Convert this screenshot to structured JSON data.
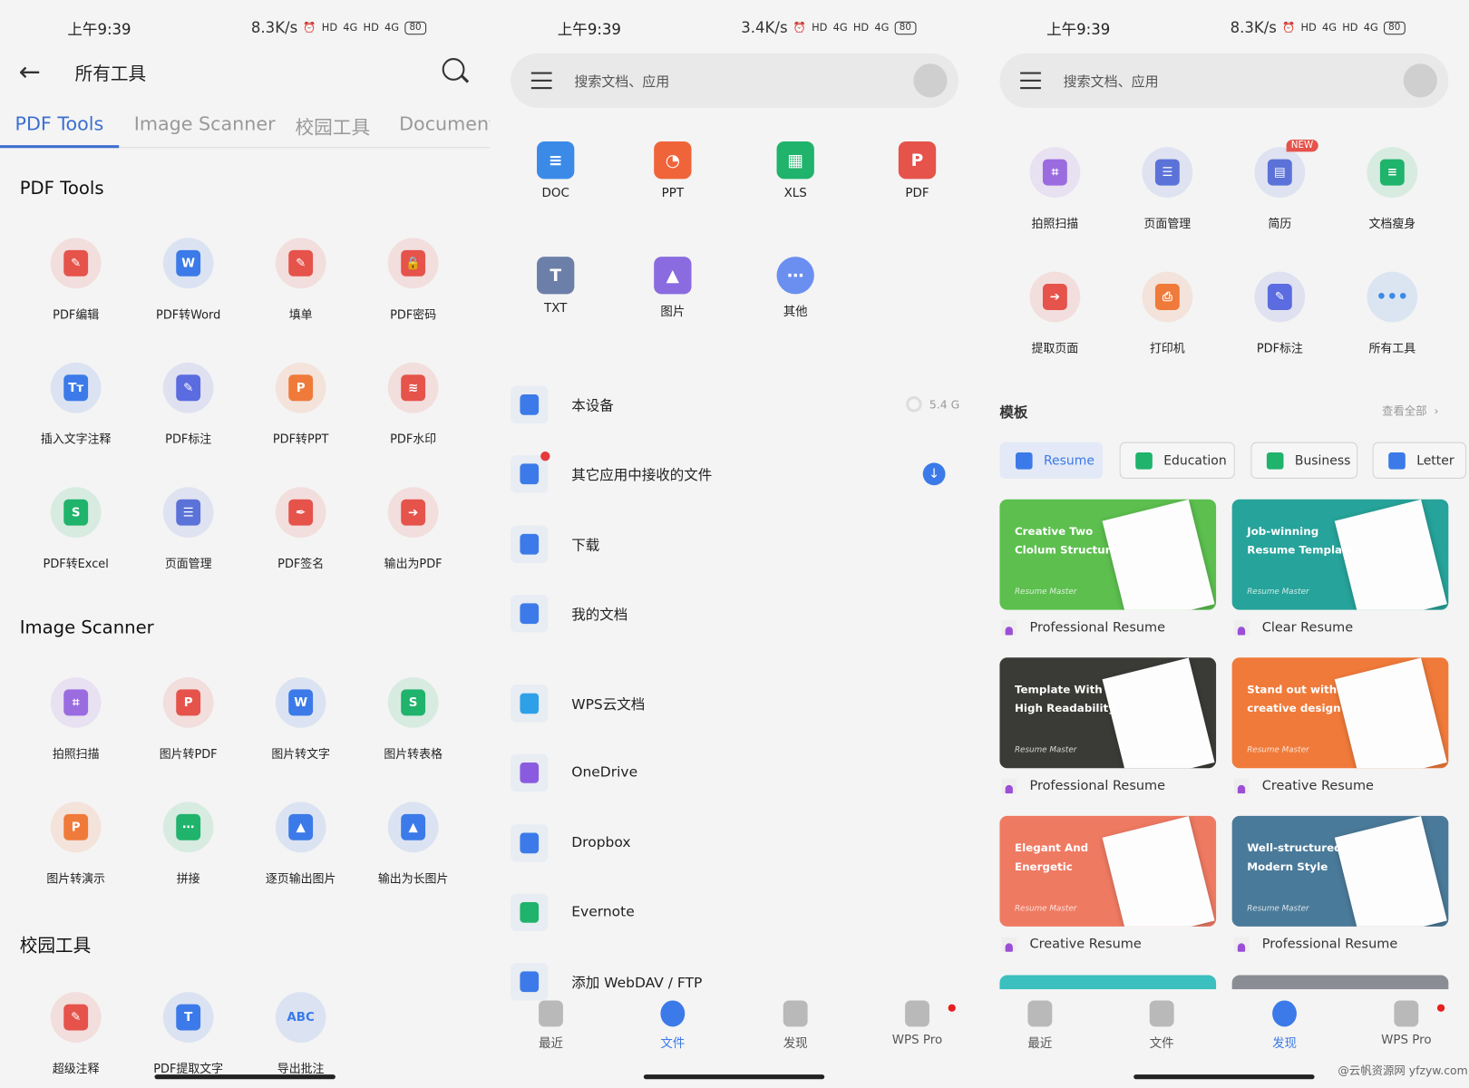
{
  "status": {
    "time": "上午9:39",
    "speeds": [
      "8.3K/s",
      "3.4K/s",
      "8.3K/s"
    ],
    "battery": "80",
    "net": "4G",
    "hd": "HD"
  },
  "left": {
    "title": "所有工具",
    "tabs": [
      "PDF Tools",
      "Image Scanner",
      "校园工具",
      "Document"
    ],
    "sections": [
      {
        "title": "PDF Tools",
        "tools": [
          {
            "label": "PDF编辑",
            "icon": "pdf-edit-icon",
            "color": "#e5534b",
            "g": "✎"
          },
          {
            "label": "PDF转Word",
            "icon": "pdf-to-word-icon",
            "color": "#3b7ae8",
            "g": "W"
          },
          {
            "label": "填单",
            "icon": "fill-form-icon",
            "color": "#e5534b",
            "g": "✎"
          },
          {
            "label": "PDF密码",
            "icon": "pdf-password-icon",
            "color": "#e5534b",
            "g": "🔒"
          },
          {
            "label": "插入文字注释",
            "icon": "text-annotation-icon",
            "color": "#3b7ae8",
            "g": "Tт"
          },
          {
            "label": "PDF标注",
            "icon": "pdf-markup-icon",
            "color": "#5b6be0",
            "g": "✎"
          },
          {
            "label": "PDF转PPT",
            "icon": "pdf-to-ppt-icon",
            "color": "#f07a3a",
            "g": "P"
          },
          {
            "label": "PDF水印",
            "icon": "pdf-watermark-icon",
            "color": "#e5534b",
            "g": "≋"
          },
          {
            "label": "PDF转Excel",
            "icon": "pdf-to-excel-icon",
            "color": "#1fb36b",
            "g": "S"
          },
          {
            "label": "页面管理",
            "icon": "page-manage-icon",
            "color": "#5b72d8",
            "g": "☰"
          },
          {
            "label": "PDF签名",
            "icon": "pdf-sign-icon",
            "color": "#e5534b",
            "g": "✒"
          },
          {
            "label": "输出为PDF",
            "icon": "export-pdf-icon",
            "color": "#e5534b",
            "g": "➔"
          }
        ]
      },
      {
        "title": "Image Scanner",
        "tools": [
          {
            "label": "拍照扫描",
            "icon": "scan-icon",
            "color": "#9b6be0",
            "g": "⌗"
          },
          {
            "label": "图片转PDF",
            "icon": "image-to-pdf-icon",
            "color": "#e5534b",
            "g": "P"
          },
          {
            "label": "图片转文字",
            "icon": "image-to-text-icon",
            "color": "#3b7ae8",
            "g": "W"
          },
          {
            "label": "图片转表格",
            "icon": "image-to-sheet-icon",
            "color": "#1fb36b",
            "g": "S"
          },
          {
            "label": "图片转演示",
            "icon": "image-to-ppt-icon",
            "color": "#f07a3a",
            "g": "P"
          },
          {
            "label": "拼接",
            "icon": "stitch-icon",
            "color": "#1fb36b",
            "g": "⋯"
          },
          {
            "label": "逐页输出图片",
            "icon": "export-pages-image-icon",
            "color": "#3b7ae8",
            "g": "▲"
          },
          {
            "label": "输出为长图片",
            "icon": "export-long-image-icon",
            "color": "#3b7ae8",
            "g": "▲"
          }
        ]
      },
      {
        "title": "校园工具",
        "tools": [
          {
            "label": "超级注释",
            "icon": "super-annotation-icon",
            "color": "#e5534b",
            "g": "✎"
          },
          {
            "label": "PDF提取文字",
            "icon": "pdf-extract-text-icon",
            "color": "#3b7ae8",
            "g": "T"
          },
          {
            "label": "导出批注",
            "icon": "export-comments-icon",
            "color": "#3b7ae8",
            "g": "ABC"
          }
        ]
      }
    ]
  },
  "middle": {
    "search_placeholder": "搜索文档、应用",
    "apps": [
      {
        "label": "DOC",
        "color": "#3b8ae8",
        "g": "≡"
      },
      {
        "label": "PPT",
        "color": "#f0643a",
        "g": "◔"
      },
      {
        "label": "XLS",
        "color": "#1fb36b",
        "g": "▦"
      },
      {
        "label": "PDF",
        "color": "#e5534b",
        "g": "P"
      },
      {
        "label": "TXT",
        "color": "#6c7fa8",
        "g": "T"
      },
      {
        "label": "图片",
        "color": "#8a6be0",
        "g": "▲"
      },
      {
        "label": "其他",
        "color": "#6b8ff0",
        "g": "⋯"
      }
    ],
    "locations": [
      {
        "label": "本设备",
        "icon": "phone-icon",
        "color": "#3b7ae8",
        "extra": "5.4 G"
      },
      {
        "label": "其它应用中接收的文件",
        "icon": "received-files-icon",
        "color": "#3b7ae8",
        "badge": true
      },
      {
        "label": "下载",
        "icon": "download-icon",
        "color": "#3b7ae8"
      },
      {
        "label": "我的文档",
        "icon": "folder-icon",
        "color": "#3b7ae8"
      },
      {
        "label": "WPS云文档",
        "icon": "cloud-cube-icon",
        "color": "#2da0e8"
      },
      {
        "label": "OneDrive",
        "icon": "onedrive-icon",
        "color": "#8a5be0"
      },
      {
        "label": "Dropbox",
        "icon": "dropbox-icon",
        "color": "#3b7ae8"
      },
      {
        "label": "Evernote",
        "icon": "evernote-icon",
        "color": "#1fb36b"
      },
      {
        "label": "添加 WebDAV / FTP",
        "icon": "add-icon",
        "color": "#3b7ae8"
      }
    ]
  },
  "right": {
    "search_placeholder": "搜索文档、应用",
    "tools": [
      {
        "label": "拍照扫描",
        "icon": "scan-icon",
        "color": "#9b6be0",
        "g": "⌗"
      },
      {
        "label": "页面管理",
        "icon": "page-manage-icon",
        "color": "#5b72d8",
        "g": "☰"
      },
      {
        "label": "简历",
        "icon": "resume-icon",
        "color": "#5b72d8",
        "g": "▤",
        "badge": "NEW"
      },
      {
        "label": "文档瘦身",
        "icon": "slim-doc-icon",
        "color": "#1fb36b",
        "g": "≡"
      },
      {
        "label": "提取页面",
        "icon": "extract-page-icon",
        "color": "#e5534b",
        "g": "➔"
      },
      {
        "label": "打印机",
        "icon": "printer-icon",
        "color": "#f07a3a",
        "g": "⎙"
      },
      {
        "label": "PDF标注",
        "icon": "pdf-markup-icon",
        "color": "#5b6be0",
        "g": "✎"
      },
      {
        "label": "所有工具",
        "icon": "more-icon",
        "color": "#3b8ae8",
        "g": "•••"
      }
    ],
    "templates_title": "模板",
    "view_all": "查看全部",
    "chips": [
      {
        "label": "Resume",
        "color": "#3b7ae8",
        "selected": true
      },
      {
        "label": "Education",
        "color": "#1fb36b"
      },
      {
        "label": "Business",
        "color": "#1fb36b"
      },
      {
        "label": "Letter",
        "color": "#3b7ae8"
      }
    ],
    "cards": [
      {
        "title": "Creative Two\nClolum Structure",
        "brand": "Resume Master",
        "label": "Professional Resume",
        "color": "#5cbf4e"
      },
      {
        "title": "Job-winning\nResume Template",
        "brand": "Resume Master",
        "label": "Clear Resume",
        "color": "#26a39a"
      },
      {
        "title": "Template With\nHigh Readability",
        "brand": "Resume Master",
        "label": "Professional Resume",
        "color": "#3a3a36"
      },
      {
        "title": "Stand out with\ncreative design",
        "brand": "Resume Master",
        "label": "Creative Resume",
        "color": "#f07a3a"
      },
      {
        "title": "Elegant And Energetic",
        "brand": "Resume Master",
        "label": "Creative Resume",
        "color": "#ef7a62"
      },
      {
        "title": "Well-structured\nModern Style",
        "brand": "Resume Master",
        "label": "Professional Resume",
        "color": "#4a7a99"
      }
    ],
    "watermark": "@云帆资源网 yfzyw.com"
  },
  "nav": [
    {
      "label": "最近",
      "icon": "recent-icon"
    },
    {
      "label": "文件",
      "icon": "files-icon"
    },
    {
      "label": "发现",
      "icon": "discover-icon"
    },
    {
      "label": "WPS Pro",
      "icon": "wps-pro-icon"
    }
  ]
}
